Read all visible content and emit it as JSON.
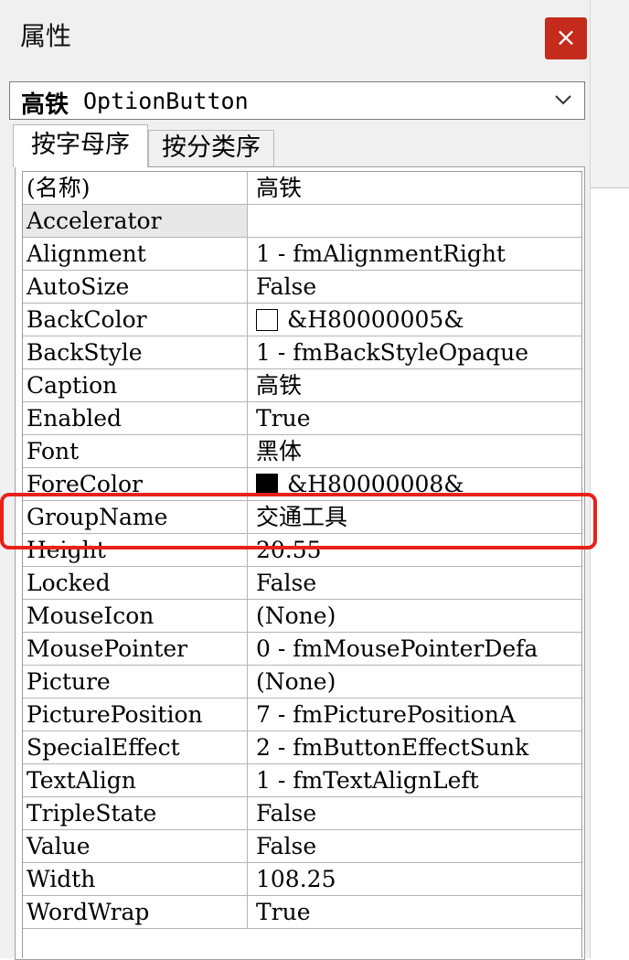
{
  "window": {
    "title": "属性",
    "close_label": "×"
  },
  "object_selector": {
    "name": "高铁",
    "type": "OptionButton"
  },
  "tabs": [
    {
      "label": "按字母序"
    },
    {
      "label": "按分类序"
    }
  ],
  "properties": [
    {
      "name": "(名称)",
      "value": "高铁"
    },
    {
      "name": "Accelerator",
      "value": ""
    },
    {
      "name": "Alignment",
      "value": "1 - fmAlignmentRight"
    },
    {
      "name": "AutoSize",
      "value": "False"
    },
    {
      "name": "BackColor",
      "value": "&H80000005&",
      "swatch": "#ffffff"
    },
    {
      "name": "BackStyle",
      "value": "1 - fmBackStyleOpaque"
    },
    {
      "name": "Caption",
      "value": "高铁"
    },
    {
      "name": "Enabled",
      "value": "True"
    },
    {
      "name": "Font",
      "value": "黑体"
    },
    {
      "name": "ForeColor",
      "value": "&H80000008&",
      "swatch": "#000000"
    },
    {
      "name": "GroupName",
      "value": "交通工具"
    },
    {
      "name": "Height",
      "value": "20.55"
    },
    {
      "name": "Locked",
      "value": "False"
    },
    {
      "name": "MouseIcon",
      "value": "(None)"
    },
    {
      "name": "MousePointer",
      "value": "0 - fmMousePointerDefa"
    },
    {
      "name": "Picture",
      "value": "(None)"
    },
    {
      "name": "PicturePosition",
      "value": "7 - fmPicturePositionA"
    },
    {
      "name": "SpecialEffect",
      "value": "2 - fmButtonEffectSunk"
    },
    {
      "name": "TextAlign",
      "value": "1 - fmTextAlignLeft"
    },
    {
      "name": "TripleState",
      "value": "False"
    },
    {
      "name": "Value",
      "value": "False"
    },
    {
      "name": "Width",
      "value": "108.25"
    },
    {
      "name": "WordWrap",
      "value": "True"
    }
  ],
  "selected_property": "Accelerator",
  "highlighted_property": "GroupName",
  "colors": {
    "close_button": "#c42b1c",
    "highlight": "#e8211a"
  }
}
